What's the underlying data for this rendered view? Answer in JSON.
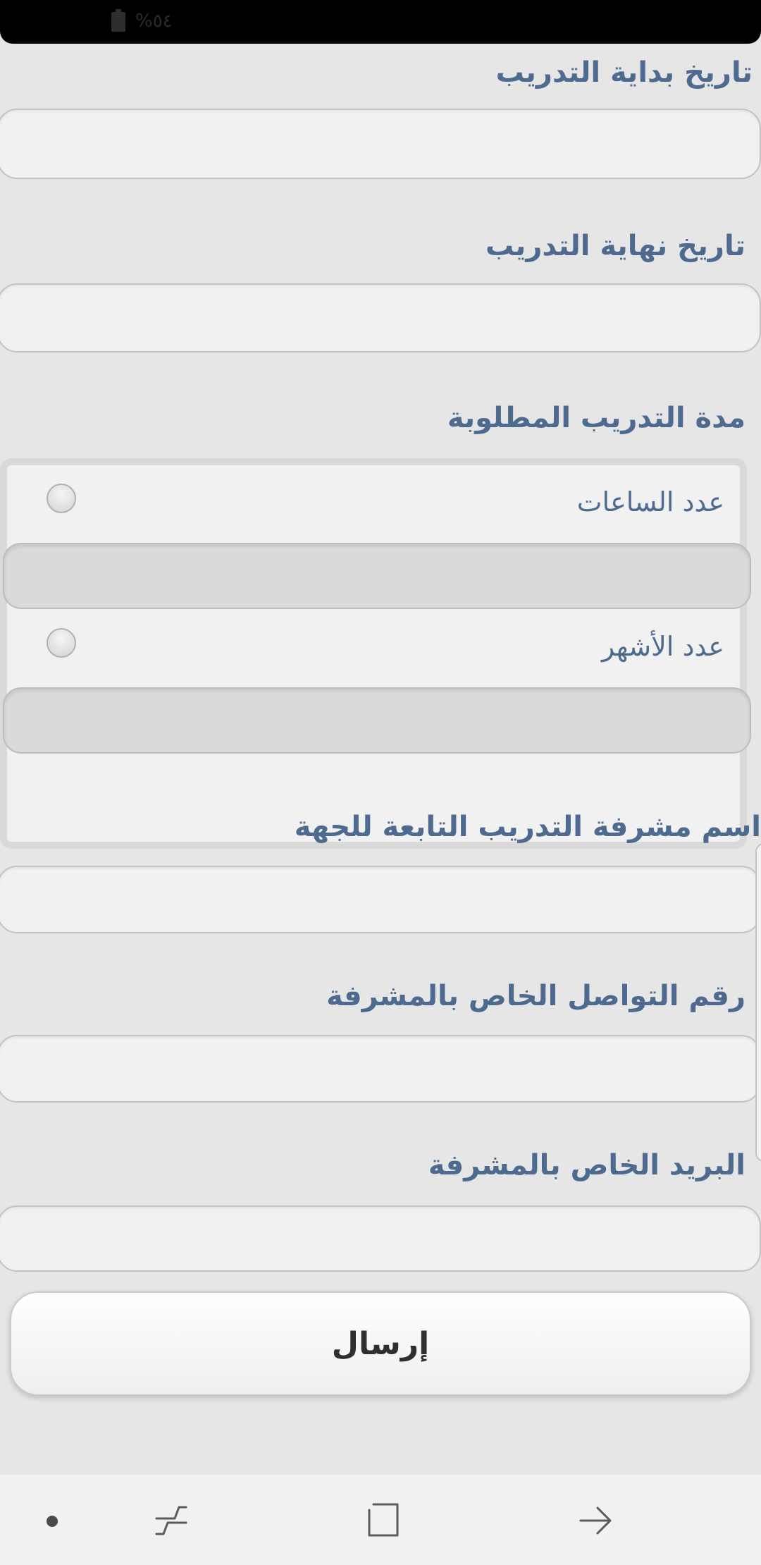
{
  "status_bar": {
    "battery_text": "%٥٤",
    "battery_icon": "battery-icon"
  },
  "form": {
    "start_date": {
      "label": "تاريخ بداية التدريب",
      "value": ""
    },
    "end_date": {
      "label": "تاريخ نهاية التدريب",
      "value": ""
    },
    "duration": {
      "label": "مدة التدريب المطلوبة",
      "hours_option": {
        "label": "عدد الساعات",
        "selected": false,
        "value": ""
      },
      "months_option": {
        "label": "عدد الأشهر",
        "selected": false,
        "value": ""
      }
    },
    "supervisor_name": {
      "label": "اسم مشرفة التدريب التابعة للجهة",
      "value": ""
    },
    "supervisor_phone": {
      "label": "رقم التواصل الخاص بالمشرفة",
      "value": ""
    },
    "supervisor_email": {
      "label": "البريد الخاص بالمشرفة",
      "value": ""
    },
    "submit_label": "إرسال"
  },
  "nav_bar": {
    "icons": [
      "dot-icon",
      "recent-apps-icon",
      "home-icon",
      "back-icon"
    ]
  },
  "colors": {
    "label": "#4e6a8e",
    "background": "#e6e6e6",
    "input_fill": "#f1f1f1"
  }
}
